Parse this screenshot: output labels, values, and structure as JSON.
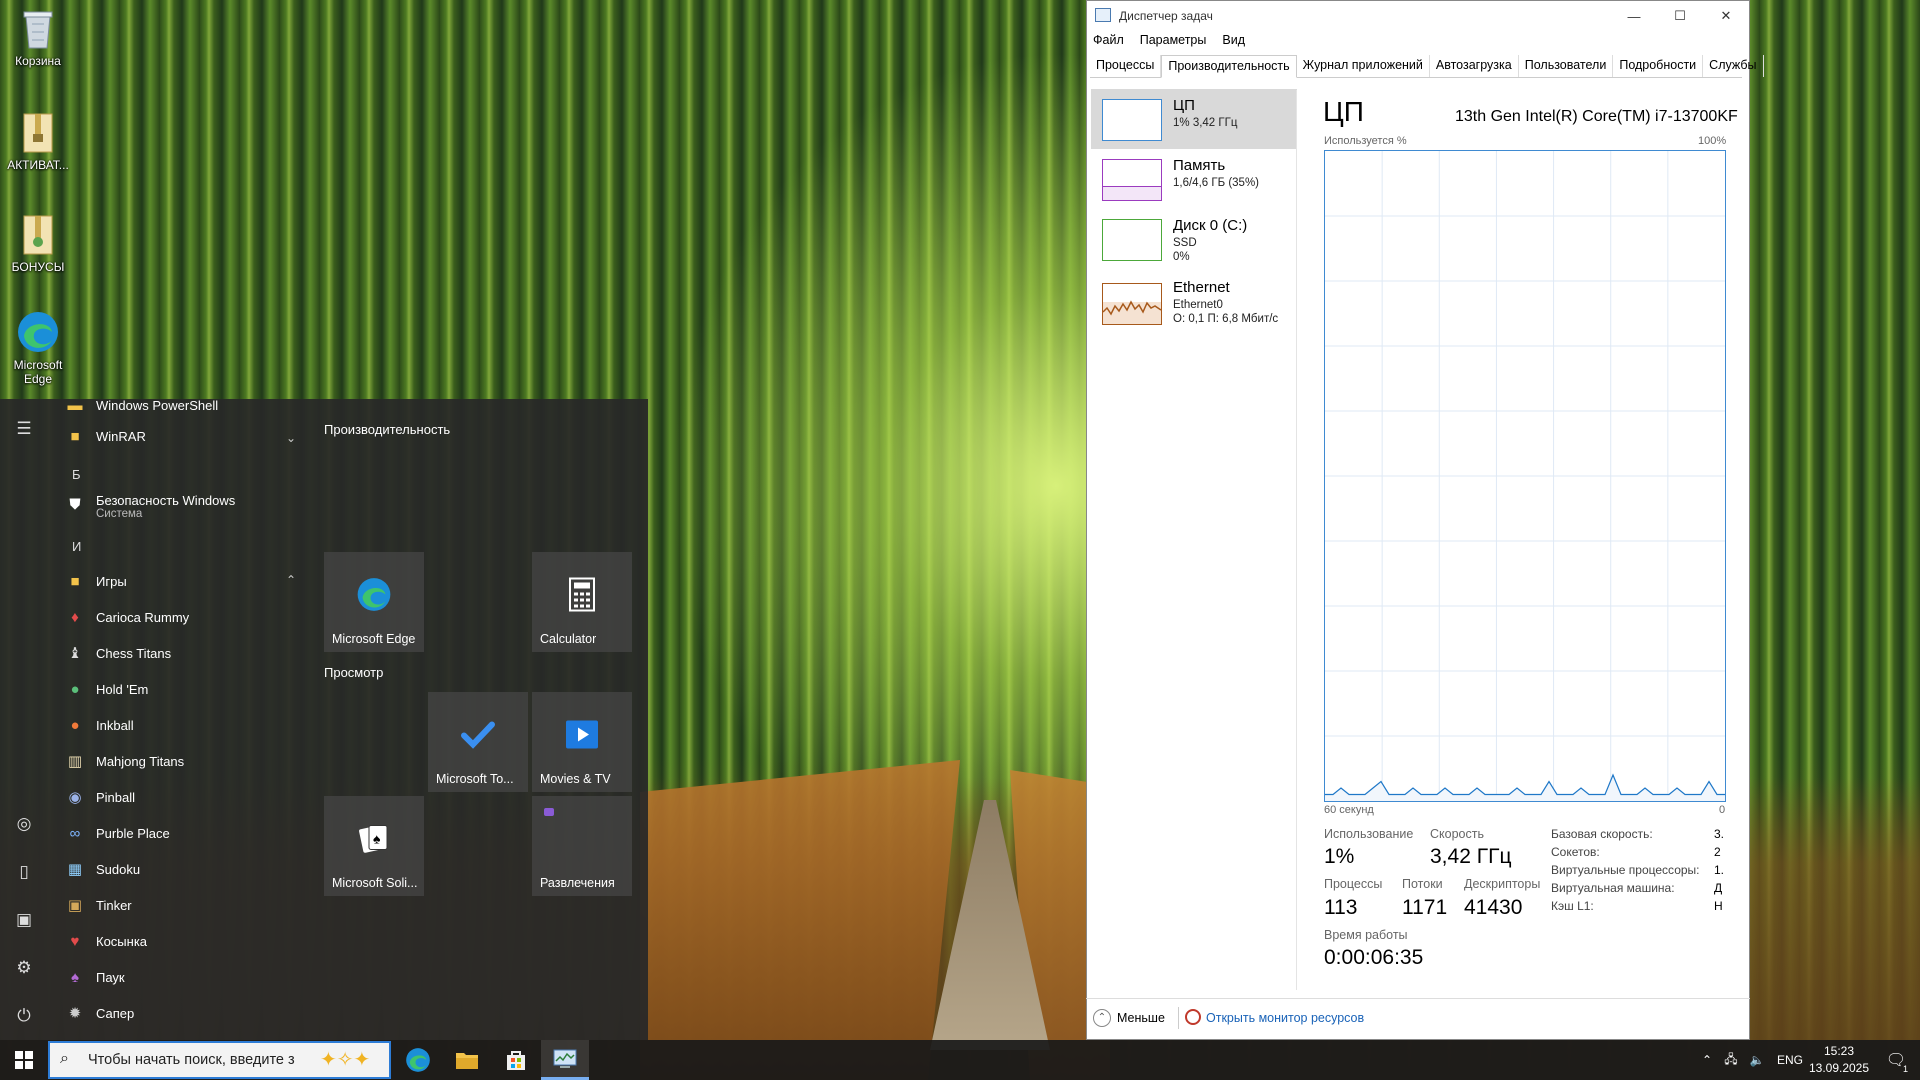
{
  "desktop": {
    "icons": [
      {
        "label": "Корзина",
        "icon": "recycle-bin-icon"
      },
      {
        "label": "АКТИВАТ...",
        "icon": "folder-zip-icon"
      },
      {
        "label": "БОНУСЫ",
        "icon": "folder-zip-icon"
      },
      {
        "label": "Microsoft Edge",
        "icon": "edge-icon"
      }
    ]
  },
  "start_menu": {
    "apps": {
      "partial_top": "Windows PowerShell",
      "winrar": "WinRAR",
      "letter_b": "Б",
      "security": "Безопасность Windows",
      "security_sub": "Система",
      "letter_i": "И",
      "games_folder": "Игры",
      "games": [
        "Carioca Rummy",
        "Chess Titans",
        "Hold 'Em",
        "Inkball",
        "Mahjong Titans",
        "Pinball",
        "Purble Place",
        "Sudoku",
        "Tinker",
        "Косынка",
        "Паук",
        "Сапер"
      ]
    },
    "groups": {
      "productivity": "Производительность",
      "browse": "Просмотр"
    },
    "tiles": {
      "edge": "Microsoft Edge",
      "calculator": "Calculator",
      "todo": "Microsoft To...",
      "movies": "Movies & TV",
      "solitaire": "Microsoft Soli...",
      "entertainment": "Развлечения"
    }
  },
  "task_manager": {
    "title": "Диспетчер задач",
    "menu": [
      "Файл",
      "Параметры",
      "Вид"
    ],
    "tabs": [
      "Процессы",
      "Производительность",
      "Журнал приложений",
      "Автозагрузка",
      "Пользователи",
      "Подробности",
      "Службы"
    ],
    "active_tab": "Производительность",
    "side": {
      "cpu": {
        "name": "ЦП",
        "sub": "1% 3,42 ГГц"
      },
      "memory": {
        "name": "Память",
        "sub": "1,6/4,6 ГБ (35%)"
      },
      "disk": {
        "name": "Диск 0 (C:)",
        "sub1": "SSD",
        "sub2": "0%"
      },
      "ethernet": {
        "name": "Ethernet",
        "sub1": "Ethernet0",
        "sub2": "О: 0,1 П: 6,8 Мбит/с"
      }
    },
    "main": {
      "title": "ЦП",
      "cpu_model": "13th Gen Intel(R) Core(TM) i7-13700KF",
      "usage_label": "Используется %",
      "max_label": "100%",
      "time_label": "60 секунд",
      "min_label": "0",
      "utilization_label": "Использование",
      "utilization_value": "1%",
      "speed_label": "Скорость",
      "speed_value": "3,42 ГГц",
      "processes_label": "Процессы",
      "processes_value": "113",
      "threads_label": "Потоки",
      "threads_value": "1171",
      "handles_label": "Дескрипторы",
      "handles_value": "41430",
      "uptime_label": "Время работы",
      "uptime_value": "0:00:06:35",
      "details": [
        {
          "label": "Базовая скорость:",
          "value": "3."
        },
        {
          "label": "Сокетов:",
          "value": "2"
        },
        {
          "label": "Виртуальные процессоры:",
          "value": "1."
        },
        {
          "label": "Виртуальная машина:",
          "value": "Д"
        },
        {
          "label": "Кэш L1:",
          "value": "Н"
        }
      ],
      "cpu_history_percent": [
        1,
        1,
        2,
        1,
        1,
        1,
        2,
        3,
        1,
        1,
        1,
        2,
        1,
        1,
        1,
        2,
        1,
        1,
        1,
        2,
        1,
        1,
        1,
        1,
        2,
        1,
        1,
        1,
        3,
        1,
        1,
        1,
        2,
        1,
        1,
        1,
        4,
        1,
        1,
        1,
        2,
        1,
        1,
        1,
        2,
        1,
        1,
        1,
        3,
        1,
        1
      ]
    },
    "footer": {
      "less": "Меньше",
      "open_monitor": "Открыть монитор ресурсов"
    }
  },
  "taskbar": {
    "search_placeholder": "Чтобы начать поиск, введите з",
    "language": "ENG",
    "time": "15:23",
    "date": "13.09.2025",
    "notification_count": "1"
  }
}
